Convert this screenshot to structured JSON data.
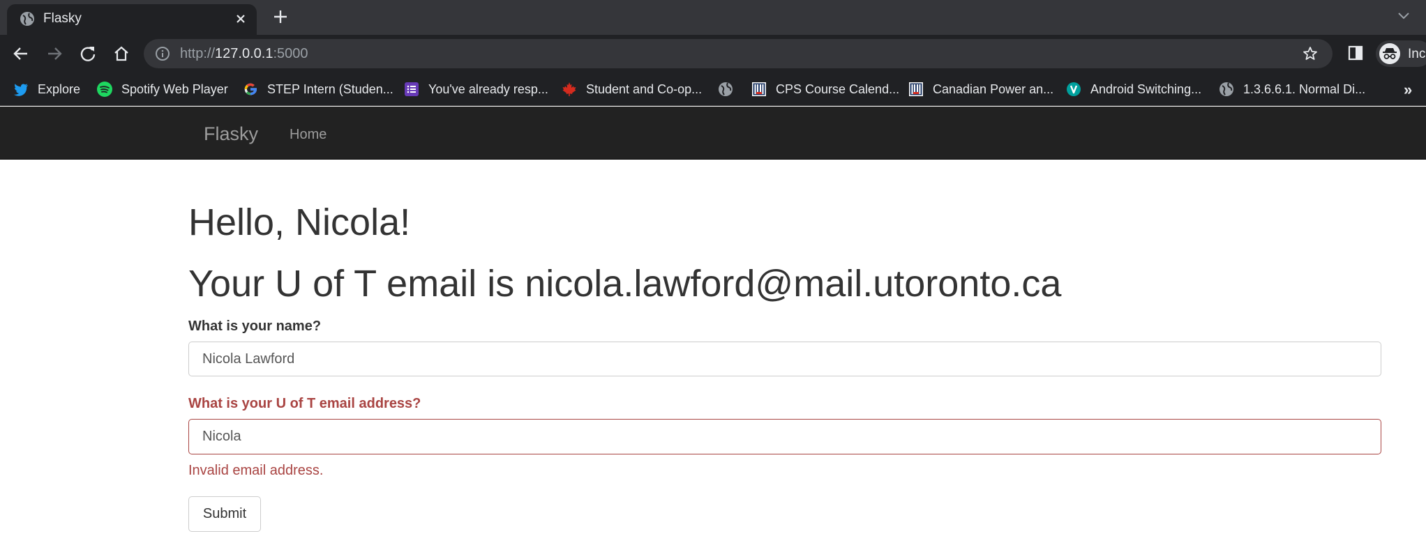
{
  "browser": {
    "tab": {
      "title": "Flasky"
    },
    "url": {
      "prefix": "http://",
      "host": "127.0.0.1",
      "port": ":5000"
    },
    "profile_label": "Inc",
    "bookmarks": [
      {
        "label": "Explore",
        "icon": "twitter-icon",
        "color": "#1d9bf0"
      },
      {
        "label": "Spotify Web Player",
        "icon": "spotify-icon",
        "color": "#1ed760"
      },
      {
        "label": "STEP Intern (Studen...",
        "icon": "google-icon",
        "color": "#4285f4"
      },
      {
        "label": "You've already resp...",
        "icon": "forms-icon",
        "color": "#673ab7"
      },
      {
        "label": "Student and Co-op...",
        "icon": "maple-leaf-icon",
        "color": "#d52b1e"
      },
      {
        "label": "",
        "icon": "globe-icon",
        "color": "#9aa0a6"
      },
      {
        "label": "CPS Course Calend...",
        "icon": "uoft-icon",
        "color": "#1e3765"
      },
      {
        "label": "Canadian Power an...",
        "icon": "uoft-icon",
        "color": "#1e3765"
      },
      {
        "label": "Android Switching...",
        "icon": "android-v-icon",
        "color": "#00a09d"
      },
      {
        "label": "1.3.6.6.1. Normal Di...",
        "icon": "globe-icon",
        "color": "#9aa0a6"
      }
    ],
    "more_bookmarks": "»"
  },
  "navbar": {
    "brand": "Flasky",
    "home": "Home"
  },
  "page": {
    "greeting": "Hello, Nicola!",
    "email_heading": "Your U of T email is nicola.lawford@mail.utoronto.ca",
    "form": {
      "name_label": "What is your name?",
      "name_value": "Nicola Lawford",
      "email_label": "What is your U of T email address?",
      "email_value": "Nicola",
      "email_error": "Invalid email address.",
      "submit_label": "Submit"
    }
  }
}
